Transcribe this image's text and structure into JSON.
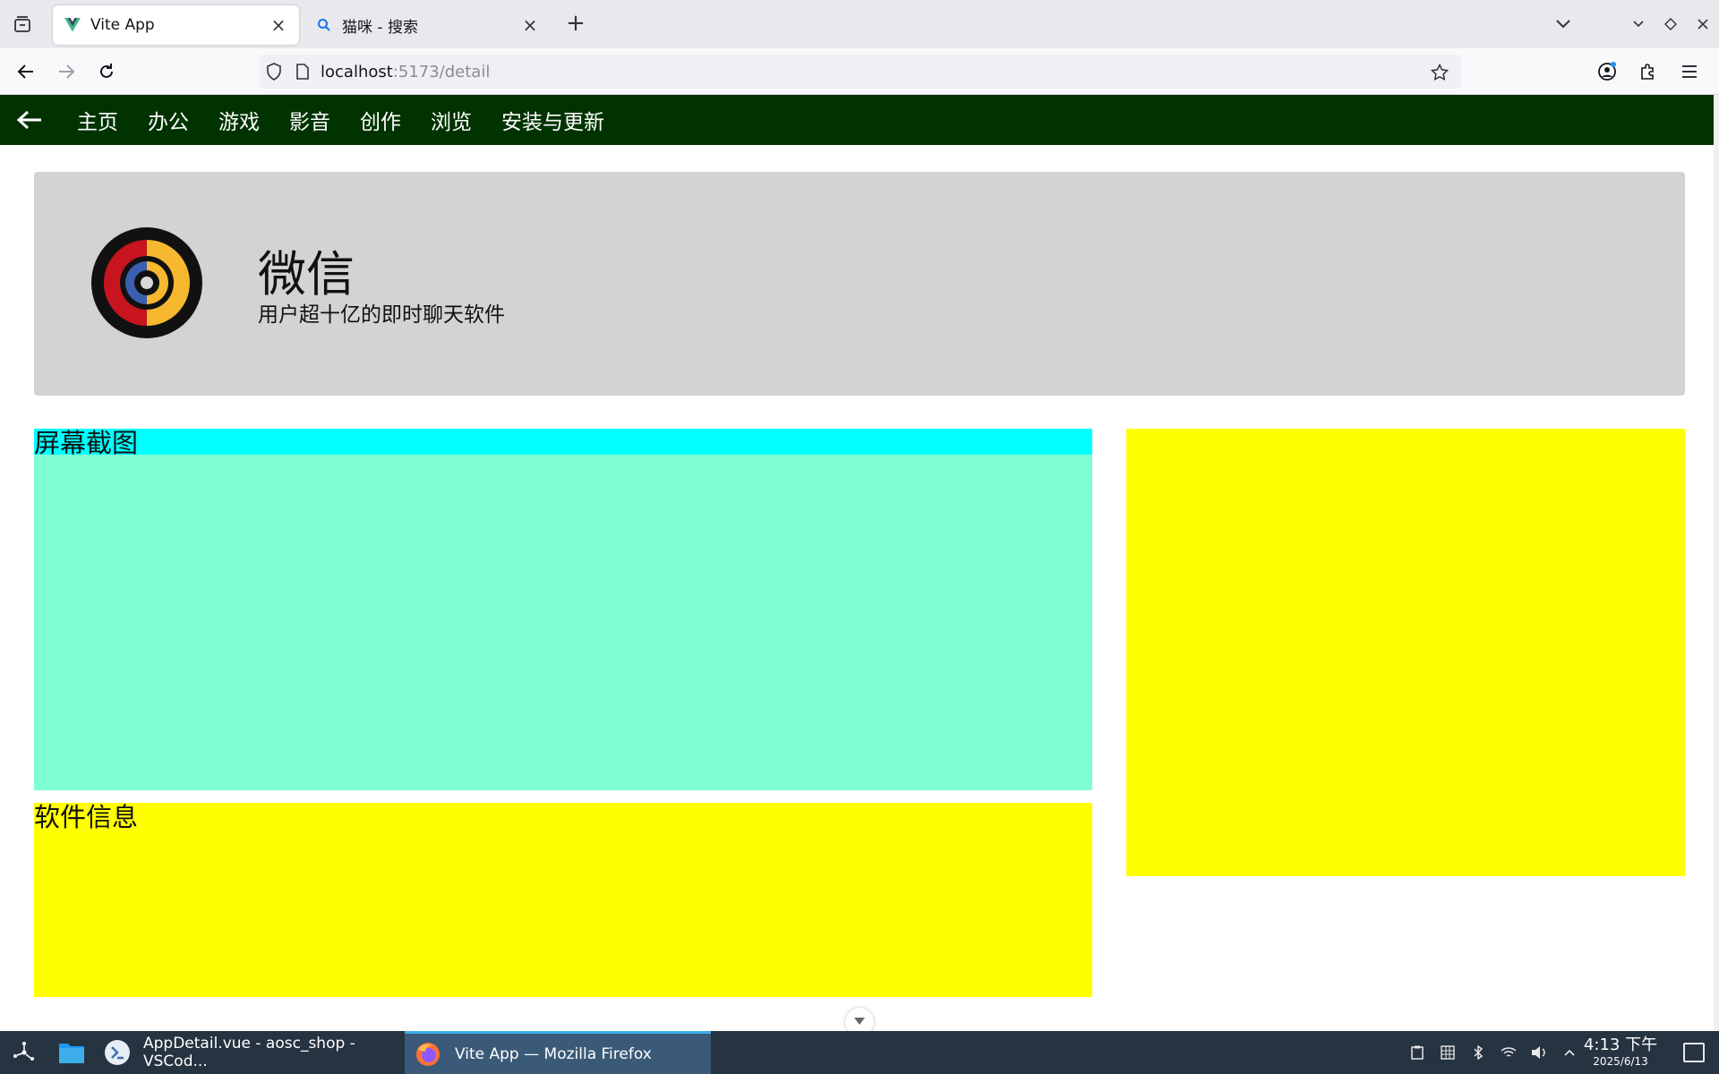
{
  "browser": {
    "tabs": [
      {
        "title": "Vite App",
        "icon": "vue-logo-icon",
        "active": true
      },
      {
        "title": "猫咪 - 搜索",
        "icon": "search-icon",
        "active": false
      }
    ],
    "url_host": "localhost",
    "url_path": ":5173/detail"
  },
  "app": {
    "nav": {
      "items": [
        "主页",
        "办公",
        "游戏",
        "影音",
        "创作",
        "浏览",
        "安装与更新"
      ],
      "bg_color": "#003300"
    },
    "detail": {
      "name": "微信",
      "description": "用户超十亿的即时聊天软件",
      "screenshots_title": "屏幕截图",
      "info_title": "软件信息"
    },
    "colors": {
      "header_bg": "#d3d3d3",
      "screenshots_bg": "#7fffd4",
      "screenshots_title_bg": "#00ffff",
      "panel_bg": "#ffff00"
    }
  },
  "taskbar": {
    "tasks": [
      {
        "label": "AppDetail.vue - aosc_shop - VSCod...",
        "icon": "vscodium-icon"
      },
      {
        "label": "Vite App — Mozilla Firefox",
        "icon": "firefox-icon",
        "active": true
      }
    ],
    "time": "4:13 下午",
    "date": "2025/6/13"
  }
}
